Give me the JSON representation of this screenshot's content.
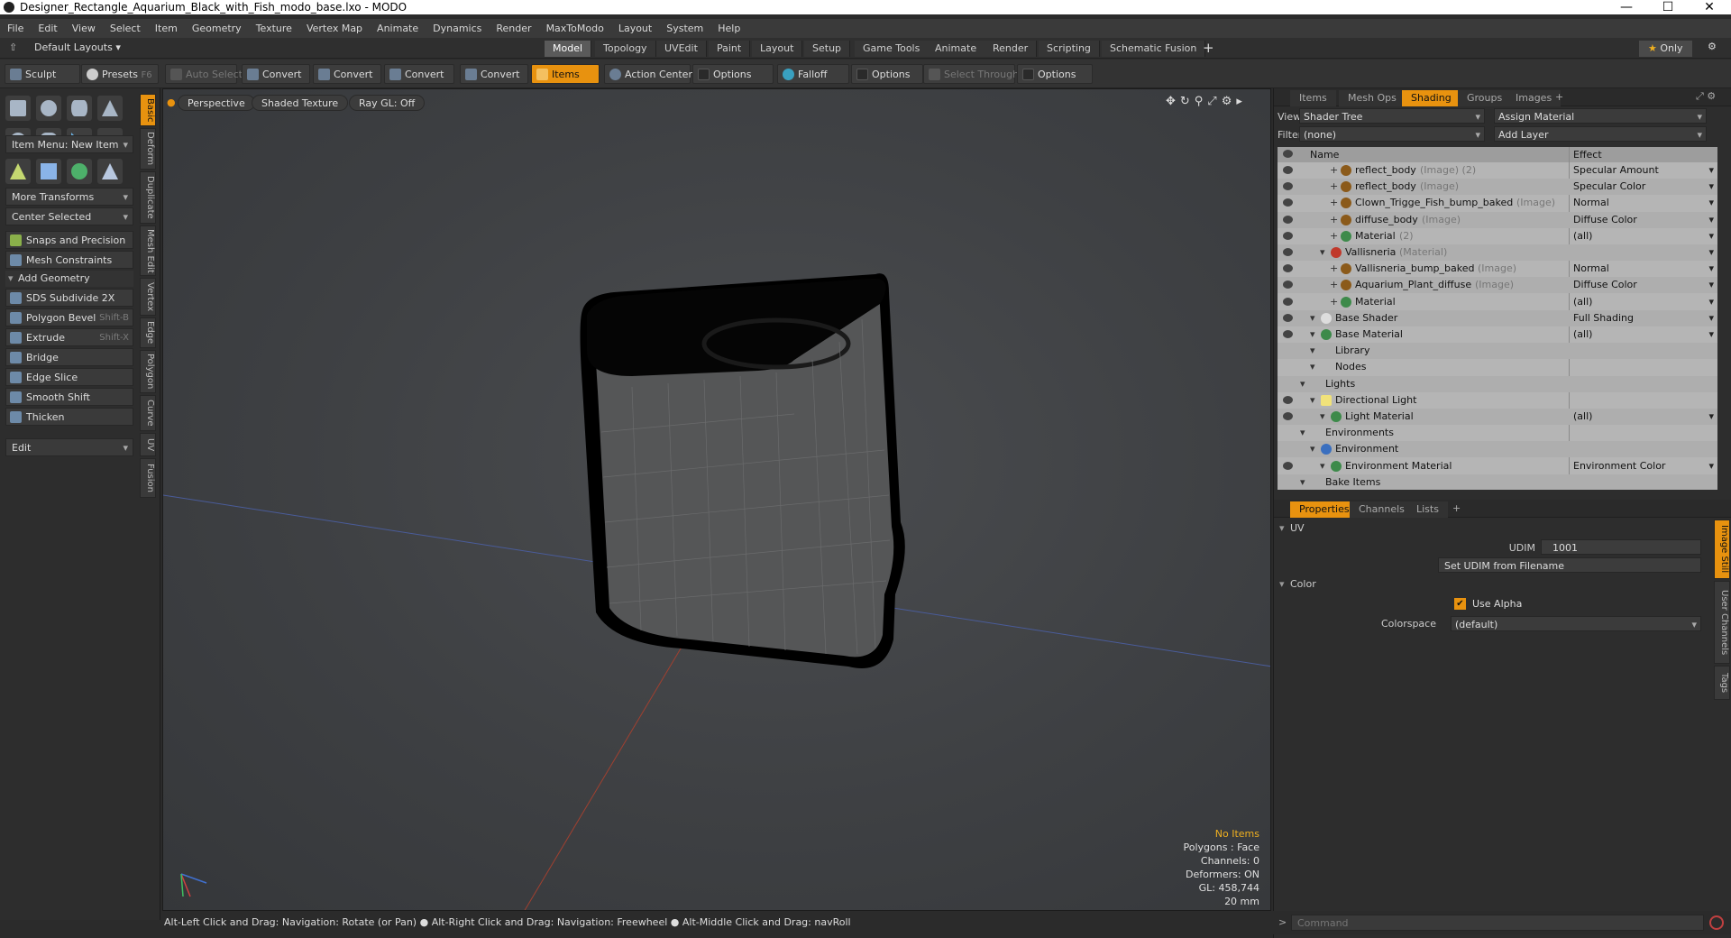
{
  "window": {
    "title": "Designer_Rectangle_Aquarium_Black_with_Fish_modo_base.lxo - MODO",
    "min": "—",
    "max": "☐",
    "close": "✕"
  },
  "menu": [
    "File",
    "Edit",
    "View",
    "Select",
    "Item",
    "Geometry",
    "Texture",
    "Vertex Map",
    "Animate",
    "Dynamics",
    "Render",
    "MaxToModo",
    "Layout",
    "System",
    "Help"
  ],
  "layoutbar": {
    "layouts_label": "Default Layouts",
    "tabs": [
      "Model",
      "Topology",
      "UVEdit",
      "Paint",
      "Layout",
      "Setup",
      "Game Tools",
      "Animate",
      "Render",
      "Scripting",
      "Schematic Fusion"
    ],
    "active_tab": "Model",
    "add": "+",
    "only_label": "Only"
  },
  "toolbar": {
    "sculpt": "Sculpt",
    "presets": "Presets",
    "presets_key": "F6",
    "auto_select": "Auto Select",
    "convert1": "Convert",
    "convert2": "Convert",
    "convert3": "Convert",
    "convert4": "Convert",
    "items": "Items",
    "action_center": "Action Center",
    "options1": "Options",
    "falloff": "Falloff",
    "options2": "Options",
    "select_through": "Select Through",
    "options3": "Options"
  },
  "leftpanel": {
    "item_menu": "Item Menu: New Item",
    "more_transforms": "More Transforms",
    "center_selected": "Center Selected",
    "snaps": "Snaps and Precision",
    "mesh_constraints": "Mesh Constraints",
    "add_geometry": "Add Geometry",
    "tools": [
      {
        "label": "SDS Subdivide 2X",
        "shortcut": ""
      },
      {
        "label": "Polygon Bevel",
        "shortcut": "Shift-B"
      },
      {
        "label": "Extrude",
        "shortcut": "Shift-X"
      },
      {
        "label": "Bridge",
        "shortcut": ""
      },
      {
        "label": "Edge Slice",
        "shortcut": ""
      },
      {
        "label": "Smooth Shift",
        "shortcut": ""
      },
      {
        "label": "Thicken",
        "shortcut": ""
      }
    ],
    "edit": "Edit",
    "vtabs": [
      "Basic",
      "Deform",
      "Duplicate",
      "Mesh Edit",
      "Vertex",
      "Edge",
      "Polygon",
      "Curve",
      "UV",
      "Fusion"
    ]
  },
  "viewport": {
    "perspective": "Perspective",
    "shaded": "Shaded Texture",
    "raygl": "Ray GL: Off",
    "stats": {
      "no_items": "No Items",
      "polygons": "Polygons : Face",
      "channels": "Channels: 0",
      "deformers": "Deformers: ON",
      "gl": "GL: 458,744",
      "scale": "20 mm"
    }
  },
  "status": "Alt-Left Click and Drag: Navigation: Rotate (or Pan) ● Alt-Right Click and Drag: Navigation: Freewheel ● Alt-Middle Click and Drag: navRoll",
  "rightpanel": {
    "tabs": [
      "Items",
      "Mesh Ops",
      "Shading",
      "Groups",
      "Images"
    ],
    "active_tab": "Shading",
    "view_label": "View",
    "view_value": "Shader Tree",
    "assign_material": "Assign Material",
    "filter_label": "Filter",
    "filter_value": "(none)",
    "add_layer": "Add Layer",
    "col_name": "Name",
    "col_effect": "Effect",
    "tree": [
      {
        "name": "reflect_body",
        "sub": "(Image) (2)",
        "effect": "Specular Amount",
        "indent": 4,
        "icon": "img",
        "eye": true,
        "dd": true
      },
      {
        "name": "reflect_body",
        "sub": "(Image)",
        "effect": "Specular Color",
        "indent": 4,
        "icon": "img",
        "eye": true,
        "dd": true
      },
      {
        "name": "Clown_Trigge_Fish_bump_baked",
        "sub": "(Image)",
        "effect": "Normal",
        "indent": 4,
        "icon": "img",
        "eye": true,
        "dd": true
      },
      {
        "name": "diffuse_body",
        "sub": "(Image)",
        "effect": "Diffuse Color",
        "indent": 4,
        "icon": "img",
        "eye": true,
        "dd": true
      },
      {
        "name": "Material",
        "sub": "(2)",
        "effect": "(all)",
        "indent": 4,
        "icon": "",
        "eye": true,
        "dd": true
      },
      {
        "name": "Vallisneria",
        "sub": "(Material)",
        "effect": "",
        "indent": 3,
        "icon": "mat",
        "eye": true,
        "dd": true
      },
      {
        "name": "Vallisneria_bump_baked",
        "sub": "(Image)",
        "effect": "Normal",
        "indent": 4,
        "icon": "img",
        "eye": true,
        "dd": true
      },
      {
        "name": "Aquarium_Plant_diffuse",
        "sub": "(Image)",
        "effect": "Diffuse Color",
        "indent": 4,
        "icon": "img",
        "eye": true,
        "dd": true
      },
      {
        "name": "Material",
        "sub": "",
        "effect": "(all)",
        "indent": 4,
        "icon": "",
        "eye": true,
        "dd": true
      },
      {
        "name": "Base Shader",
        "sub": "",
        "effect": "Full Shading",
        "indent": 2,
        "icon": "shd",
        "eye": true,
        "dd": true
      },
      {
        "name": "Base Material",
        "sub": "",
        "effect": "(all)",
        "indent": 2,
        "icon": "",
        "eye": true,
        "dd": true
      },
      {
        "name": "Library",
        "sub": "",
        "effect": "",
        "indent": 2,
        "icon": "",
        "eye": false,
        "dd": false
      },
      {
        "name": "Nodes",
        "sub": "",
        "effect": "",
        "indent": 2,
        "icon": "",
        "eye": false,
        "dd": false
      },
      {
        "name": "Lights",
        "sub": "",
        "effect": "",
        "indent": 1,
        "icon": "",
        "eye": false,
        "dd": false
      },
      {
        "name": "Directional Light",
        "sub": "",
        "effect": "",
        "indent": 2,
        "icon": "lgt",
        "eye": true,
        "dd": false
      },
      {
        "name": "Light Material",
        "sub": "",
        "effect": "(all)",
        "indent": 3,
        "icon": "",
        "eye": true,
        "dd": true
      },
      {
        "name": "Environments",
        "sub": "",
        "effect": "",
        "indent": 1,
        "icon": "",
        "eye": false,
        "dd": false
      },
      {
        "name": "Environment",
        "sub": "",
        "effect": "",
        "indent": 2,
        "icon": "env",
        "eye": false,
        "dd": false
      },
      {
        "name": "Environment Material",
        "sub": "",
        "effect": "Environment Color",
        "indent": 3,
        "icon": "",
        "eye": true,
        "dd": true
      },
      {
        "name": "Bake Items",
        "sub": "",
        "effect": "",
        "indent": 1,
        "icon": "",
        "eye": false,
        "dd": false
      }
    ],
    "prop_tabs": [
      "Properties",
      "Channels",
      "Lists"
    ],
    "prop_add": "+",
    "uv_section": "UV",
    "udim_label": "UDIM",
    "udim_value": "1001",
    "set_udim": "Set UDIM from Filename",
    "color_section": "Color",
    "use_alpha": "Use Alpha",
    "colorspace_label": "Colorspace",
    "colorspace_value": "(default)",
    "side_tabs": [
      "Image Still",
      "User Channels",
      "Tags"
    ],
    "command_placeholder": "Command"
  },
  "colors": {
    "accent": "#e8920f",
    "panel": "#2d2d2d",
    "tree_bg": "#b5b5b5"
  }
}
